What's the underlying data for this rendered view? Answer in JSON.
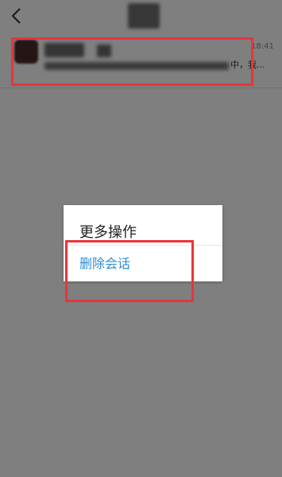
{
  "header": {
    "back_icon": "chevron-left-icon"
  },
  "conversation": {
    "time": "18:41",
    "preview_tail": "中，我..."
  },
  "dialog": {
    "title": "更多操作",
    "items": [
      {
        "label": "删除会话"
      }
    ]
  },
  "colors": {
    "highlight": "#e8353a",
    "action_text": "#2e8dd8"
  }
}
